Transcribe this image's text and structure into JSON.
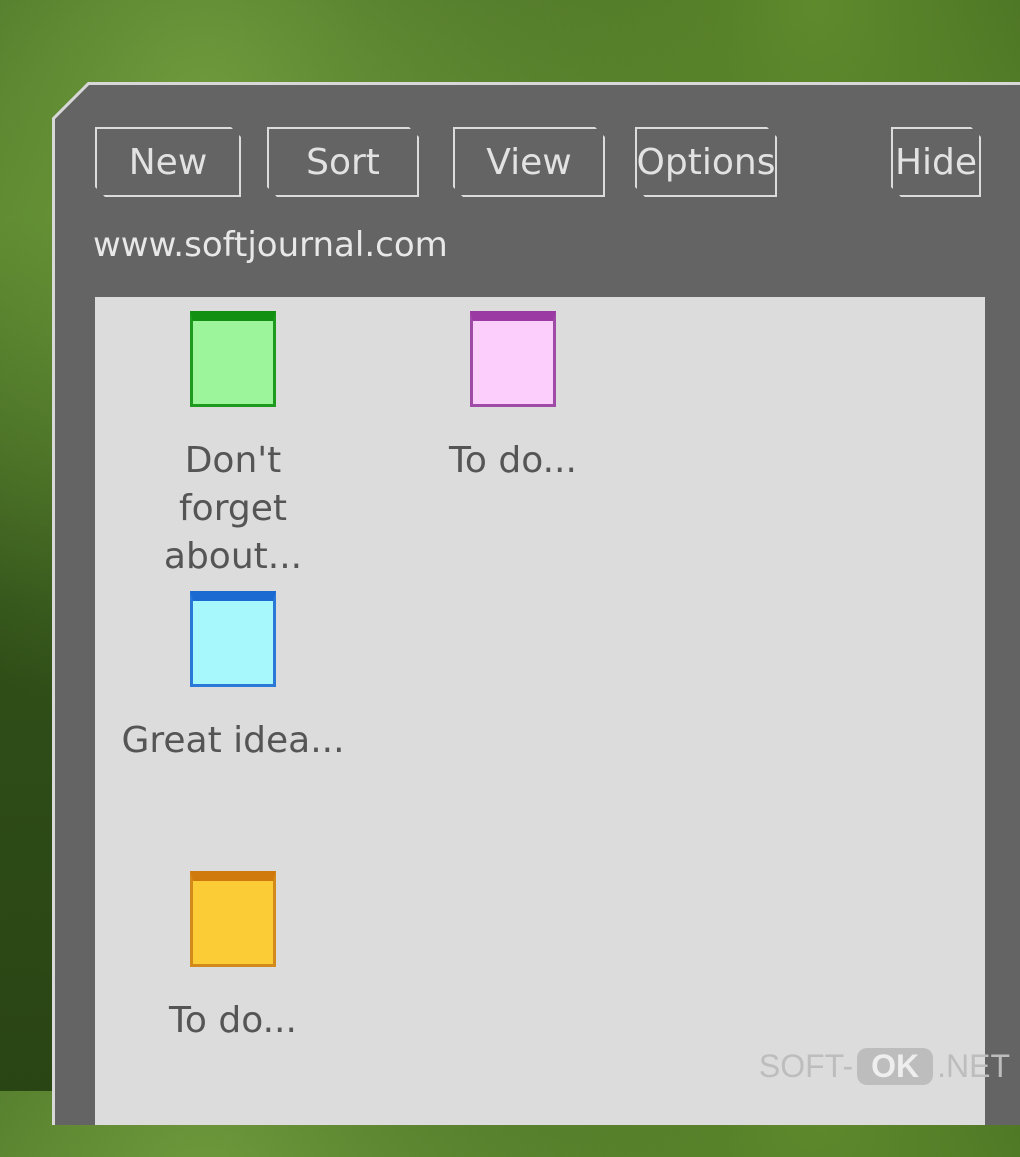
{
  "toolbar": {
    "new_label": "New",
    "sort_label": "Sort",
    "view_label": "View",
    "options_label": "Options",
    "hide_label": "Hide"
  },
  "url": "www.softjournal.com",
  "notes": [
    {
      "label": "Don't forget about...",
      "fill": "#9cf59a",
      "border": "#1e9a1e",
      "top": "#129012"
    },
    {
      "label": "To do...",
      "fill": "#fccefc",
      "border": "#a04aa8",
      "top": "#9a3aa2"
    },
    {
      "label": "Great idea...",
      "fill": "#a6f8fc",
      "border": "#2a78d8",
      "top": "#1a6ad2"
    },
    {
      "label": "To do...",
      "fill": "#fccc36",
      "border": "#d48a1a",
      "top": "#d07a0e"
    }
  ],
  "watermark": {
    "left": "SOFT-",
    "middle": "OK",
    "right": ".NET"
  }
}
